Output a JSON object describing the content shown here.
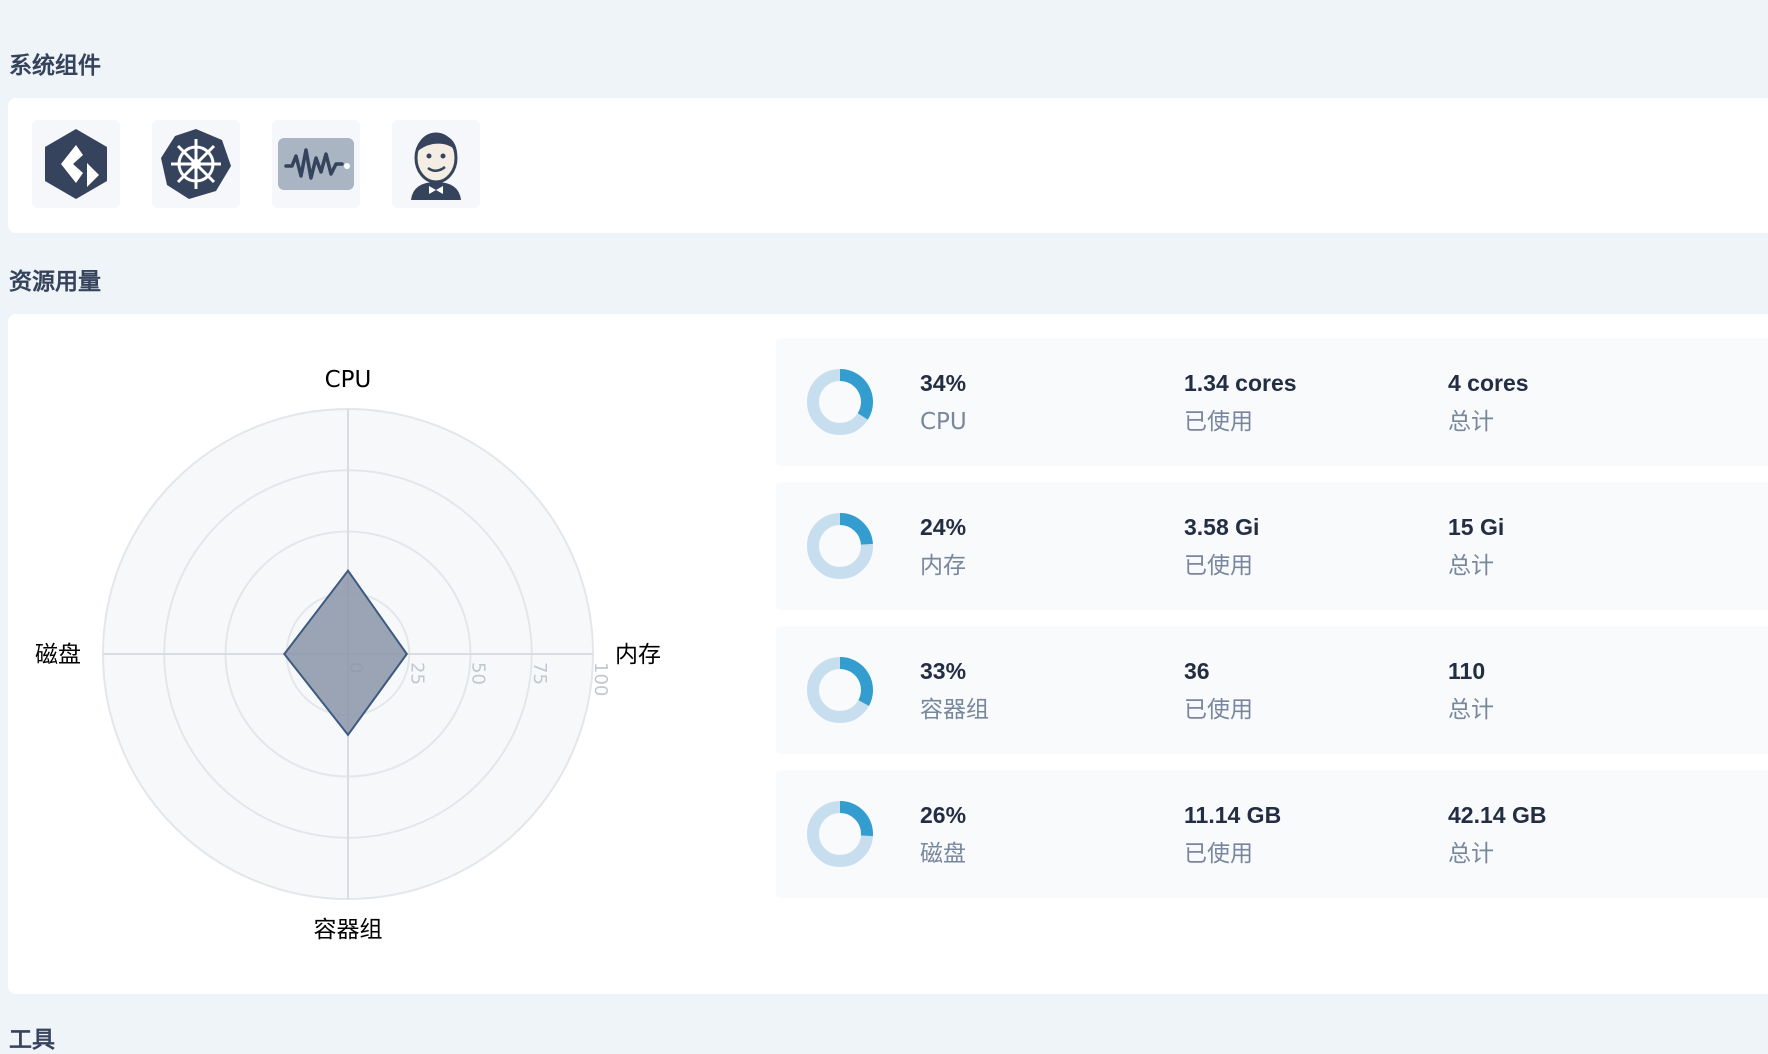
{
  "sections": {
    "components_title": "系统组件",
    "resources_title": "资源用量",
    "tools_title": "工具"
  },
  "components": [
    {
      "icon": "kubesphere-logo-icon"
    },
    {
      "icon": "kubernetes-helm-icon"
    },
    {
      "icon": "monitoring-wave-icon"
    },
    {
      "icon": "jenkins-icon"
    }
  ],
  "colors": {
    "accent": "#329dce",
    "donut_track": "#c7deef",
    "radar_fill": "#8b95a8",
    "radar_stroke": "#3d5a80"
  },
  "chart_data": {
    "type": "radar",
    "axes": [
      "CPU",
      "内存",
      "容器组",
      "磁盘"
    ],
    "values": [
      34,
      24,
      33,
      26
    ],
    "scale_ticks": [
      "0",
      "25",
      "50",
      "75",
      "100"
    ],
    "range": [
      0,
      100
    ]
  },
  "resources": [
    {
      "percent": "34%",
      "percent_value": 34,
      "name": "CPU",
      "used": "1.34 cores",
      "used_label": "已使用",
      "total": "4 cores",
      "total_label": "总计"
    },
    {
      "percent": "24%",
      "percent_value": 24,
      "name": "内存",
      "used": "3.58 Gi",
      "used_label": "已使用",
      "total": "15 Gi",
      "total_label": "总计"
    },
    {
      "percent": "33%",
      "percent_value": 33,
      "name": "容器组",
      "used": "36",
      "used_label": "已使用",
      "total": "110",
      "total_label": "总计"
    },
    {
      "percent": "26%",
      "percent_value": 26,
      "name": "磁盘",
      "used": "11.14 GB",
      "used_label": "已使用",
      "total": "42.14 GB",
      "total_label": "总计"
    }
  ]
}
